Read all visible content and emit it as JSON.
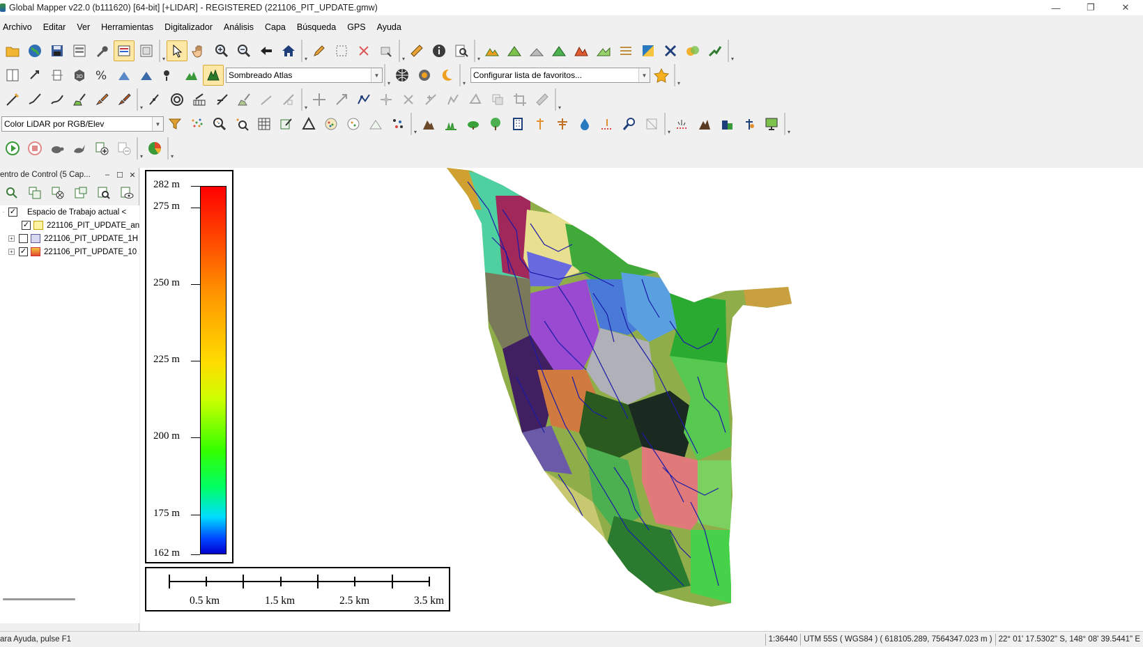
{
  "window": {
    "title": "Global Mapper  v22.0 (b111620) [64-bit] [+LIDAR] - REGISTERED (221106_PIT_UPDATE.gmw)",
    "minimize": "—",
    "restore": "❐",
    "close": "✕"
  },
  "menu": [
    "Archivo",
    "Editar",
    "Ver",
    "Herramientas",
    "Digitalizador",
    "Análisis",
    "Capa",
    "Búsqueda",
    "GPS",
    "Ayuda"
  ],
  "toolbar": {
    "shader_select": "Sombreado Atlas",
    "favorites_select": "Configurar lista de favoritos...",
    "lidar_color_select": "Color LiDAR por RGB/Elev"
  },
  "control_center": {
    "title": "entro de Control (5 Cap...",
    "workspace_label": "Espacio de Trabajo actual <",
    "layers": [
      {
        "name": "221106_PIT_UPDATE_an",
        "checked": true
      },
      {
        "name": "221106_PIT_UPDATE_1H",
        "checked": false
      },
      {
        "name": "221106_PIT_UPDATE_10",
        "checked": true
      }
    ]
  },
  "legend": {
    "labels": [
      {
        "text": "282 m",
        "value": 282
      },
      {
        "text": "275 m",
        "value": 275
      },
      {
        "text": "250 m",
        "value": 250
      },
      {
        "text": "225 m",
        "value": 225
      },
      {
        "text": "200 m",
        "value": 200
      },
      {
        "text": "175 m",
        "value": 175
      },
      {
        "text": "162 m",
        "value": 162
      }
    ],
    "min": 162,
    "max": 282
  },
  "scale_bar": {
    "labels": [
      "0.5 km",
      "1.5 km",
      "2.5 km",
      "3.5 km"
    ]
  },
  "status": {
    "help": "ara Ayuda, pulse F1",
    "scale": "1:36440",
    "projection": "UTM 55S ( WGS84 ) ( 618105.289, 7564347.023 m )",
    "geo": "22° 01' 17.5302\" S, 148° 08' 39.5441\" E"
  },
  "colors": {
    "toolbar_bg": "#f0f0f0",
    "active_tool": "#ffe7a6",
    "stream_lines": "#1a1aa8"
  }
}
